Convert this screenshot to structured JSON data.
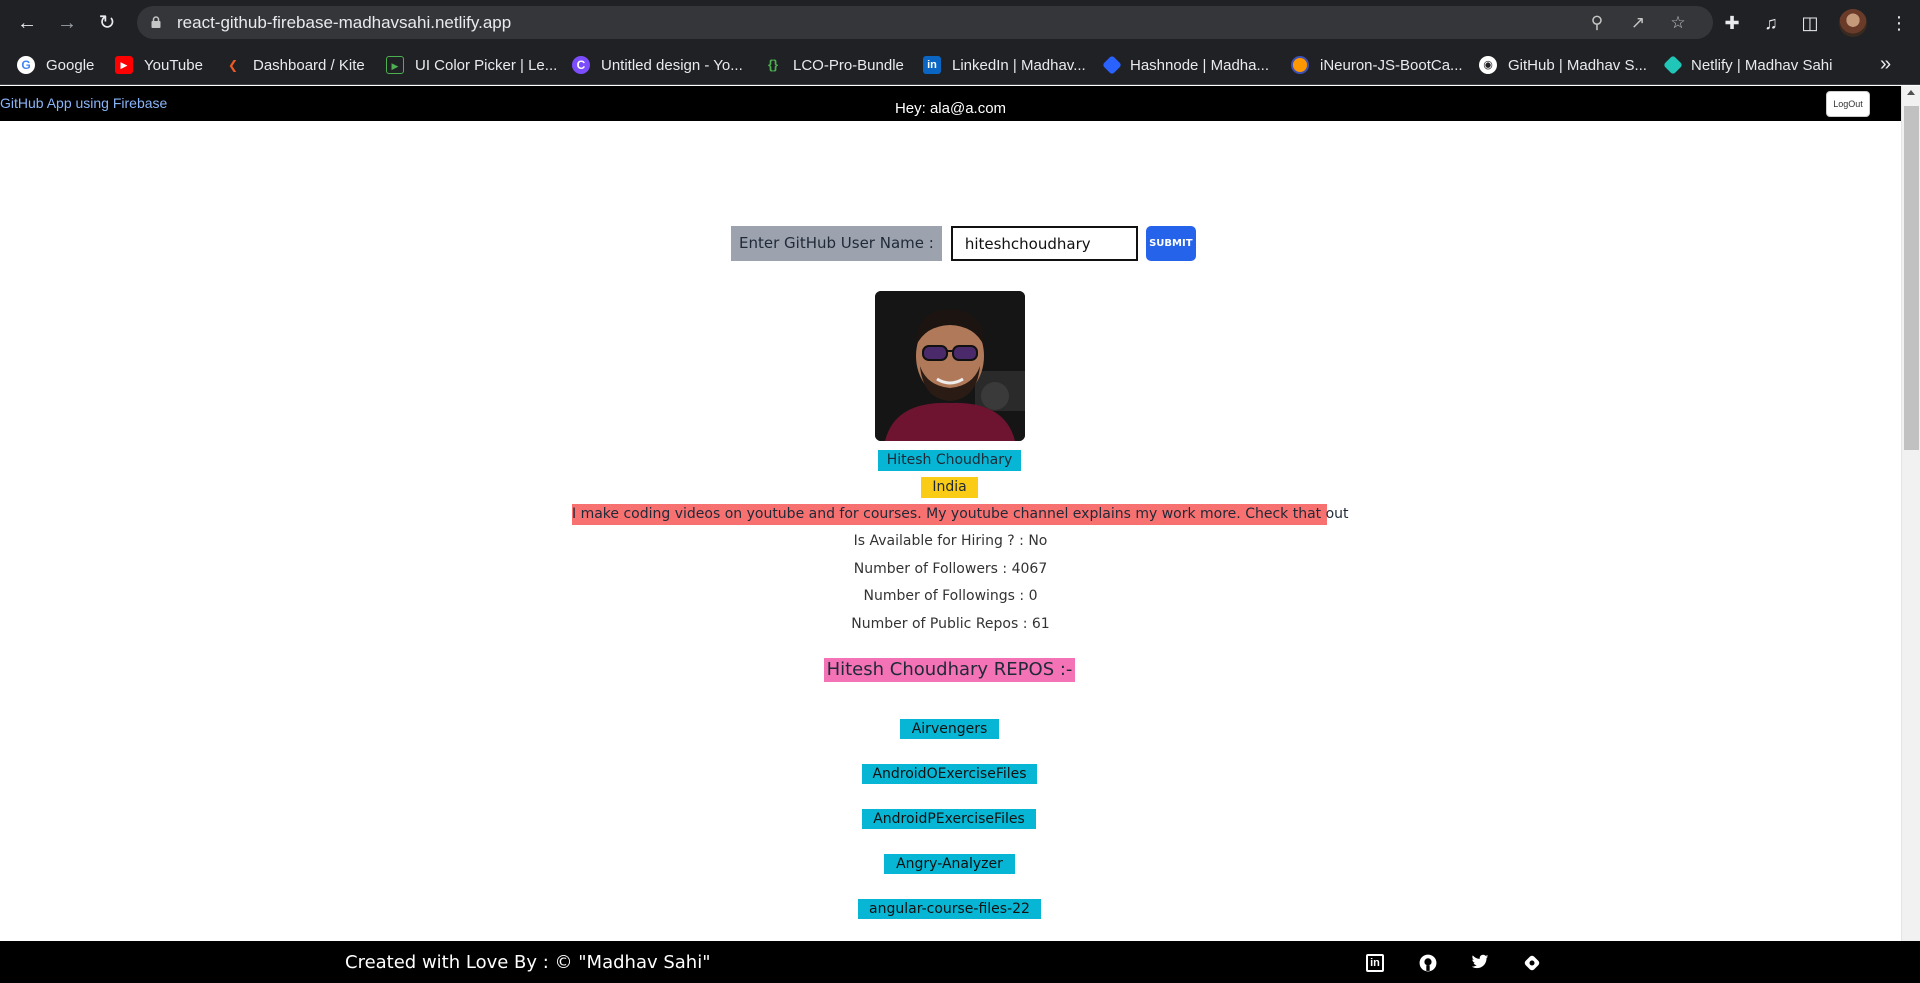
{
  "browser": {
    "url": "react-github-firebase-madhavsahi.netlify.app",
    "bookmarks": [
      {
        "label": "Google",
        "icon": "google-icon",
        "color": "#ffffff"
      },
      {
        "label": "YouTube",
        "icon": "youtube-icon",
        "color": "#ff0000"
      },
      {
        "label": "Dashboard / Kite",
        "icon": "kite-icon",
        "color": "#ee5a24"
      },
      {
        "label": "UI Color Picker | Le...",
        "icon": "color-picker-icon",
        "color": "#2e7d32"
      },
      {
        "label": "Untitled design - Yo...",
        "icon": "canva-icon",
        "color": "#7c4dff"
      },
      {
        "label": "LCO-Pro-Bundle",
        "icon": "code-braces-icon",
        "color": "#4caf50"
      },
      {
        "label": "LinkedIn | Madhav...",
        "icon": "linkedin-icon",
        "color": "#0a66c2"
      },
      {
        "label": "Hashnode | Madha...",
        "icon": "hashnode-icon",
        "color": "#2962ff"
      },
      {
        "label": "iNeuron-JS-BootCa...",
        "icon": "ineuron-icon",
        "color": "#ff9800"
      },
      {
        "label": "GitHub | Madhav S...",
        "icon": "github-icon",
        "color": "#ffffff"
      },
      {
        "label": "Netlify | Madhav Sahi",
        "icon": "netlify-icon",
        "color": "#20c6b7"
      }
    ],
    "more": "»"
  },
  "header": {
    "brand": "GitHub App using Firebase",
    "greeting": "Hey: ala@a.com",
    "logout": "LogOut"
  },
  "form": {
    "label": "Enter GitHub User Name :",
    "value": "hiteshchoudhary",
    "submit": "SUBMIT"
  },
  "profile": {
    "name": "Hitesh Choudhary",
    "location": "India",
    "bio": "I make coding videos on youtube and for courses. My youtube channel explains my work more. Check that out",
    "hiring": "Is Available for Hiring ? : No",
    "followers": "Number of Followers : 4067",
    "followings": "Number of Followings : 0",
    "public_repos": "Number of Public Repos : 61",
    "repos_title": "Hitesh Choudhary REPOS :-"
  },
  "repos": [
    "Airvengers",
    "AndroidOExerciseFiles",
    "AndroidPExerciseFiles",
    "Angry-Analyzer",
    "angular-course-files-22"
  ],
  "footer": {
    "credit": "Created with Love By : © \"Madhav Sahi\"",
    "icons": [
      "linkedin-icon",
      "github-icon",
      "twitter-icon",
      "hashnode-icon"
    ]
  },
  "colors": {
    "name_tag": "#06b6d4",
    "location_tag": "#facc15",
    "bio_tag": "#f87171",
    "repos_title": "#f472b6",
    "submit": "#2563eb",
    "header_bg": "#000000"
  }
}
